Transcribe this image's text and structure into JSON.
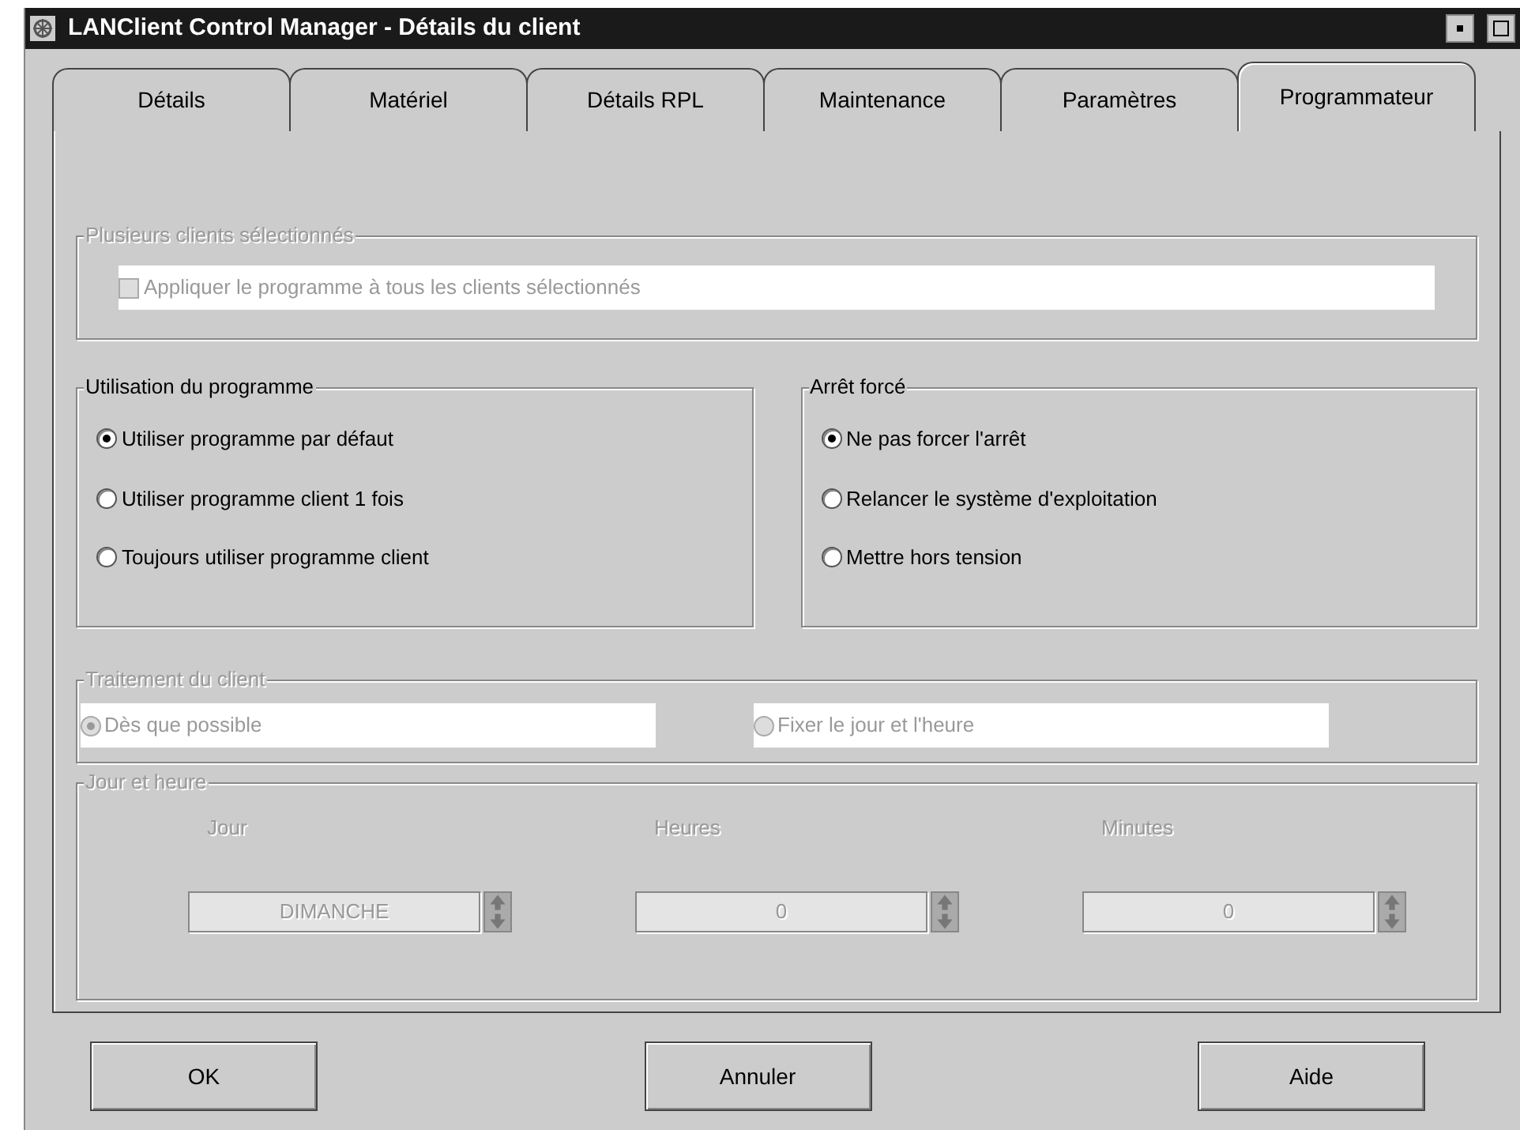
{
  "window": {
    "title": "LANClient Control Manager - Détails du client"
  },
  "tabs": [
    {
      "label": "Détails",
      "selected": false
    },
    {
      "label": "Matériel",
      "selected": false
    },
    {
      "label": "Détails RPL",
      "selected": false
    },
    {
      "label": "Maintenance",
      "selected": false
    },
    {
      "label": "Paramètres",
      "selected": false
    },
    {
      "label": "Programmateur",
      "selected": true
    }
  ],
  "multi_clients": {
    "title": "Plusieurs clients sélectionnés",
    "disabled": true,
    "checkbox": {
      "label": "Appliquer le programme à tous les clients sélectionnés",
      "checked": false
    }
  },
  "program_use": {
    "title": "Utilisation du programme",
    "disabled": false,
    "options": [
      {
        "label": "Utiliser programme par défaut",
        "selected": true
      },
      {
        "label": "Utiliser programme client 1 fois",
        "selected": false
      },
      {
        "label": "Toujours utiliser programme client",
        "selected": false
      }
    ]
  },
  "forced_stop": {
    "title": "Arrêt forcé",
    "disabled": false,
    "options": [
      {
        "label": "Ne pas forcer l'arrêt",
        "selected": true
      },
      {
        "label": "Relancer le système d'exploitation",
        "selected": false
      },
      {
        "label": "Mettre hors tension",
        "selected": false
      }
    ]
  },
  "client_processing": {
    "title": "Traitement du client",
    "disabled": true,
    "options": [
      {
        "label": "Dès que possible",
        "selected": true
      },
      {
        "label": "Fixer le jour et l'heure",
        "selected": false
      }
    ]
  },
  "day_time": {
    "title": "Jour et heure",
    "disabled": true,
    "spinners": [
      {
        "label": "Jour",
        "value": "DIMANCHE"
      },
      {
        "label": "Heures",
        "value": "0"
      },
      {
        "label": "Minutes",
        "value": "0"
      }
    ]
  },
  "buttons": [
    "OK",
    "Annuler",
    "Aide"
  ]
}
